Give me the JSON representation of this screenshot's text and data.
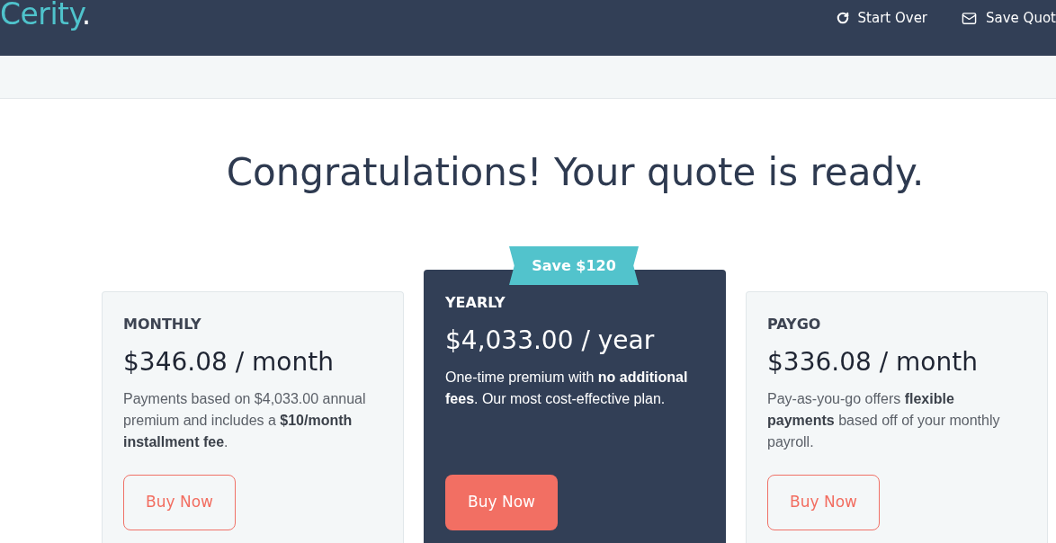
{
  "header": {
    "logo": "Cerity.",
    "actions": [
      {
        "kind": "restart",
        "label": "Start Over"
      },
      {
        "kind": "save",
        "label": "Save Quot"
      }
    ]
  },
  "heading": "Congratulations! Your quote is ready.",
  "plans": [
    {
      "name": "MONTHLY",
      "price": "$346.08 / month",
      "description": "Payments based on $4,033.00 annual premium and includes a **$10/month installment fee**.",
      "button": "Buy Now",
      "featured": false
    },
    {
      "name": "YEARLY",
      "badge": "Save $120",
      "price": "$4,033.00 / year",
      "description": "One-time premium with **no additional fees**. Our most cost-effective plan.",
      "button": "Buy Now",
      "featured": true
    },
    {
      "name": "PAYGO",
      "price": "$336.08 / month",
      "description": "Pay-as-you-go offers **flexible payments** based off of your monthly payroll.",
      "button": "Buy Now",
      "featured": false
    }
  ]
}
